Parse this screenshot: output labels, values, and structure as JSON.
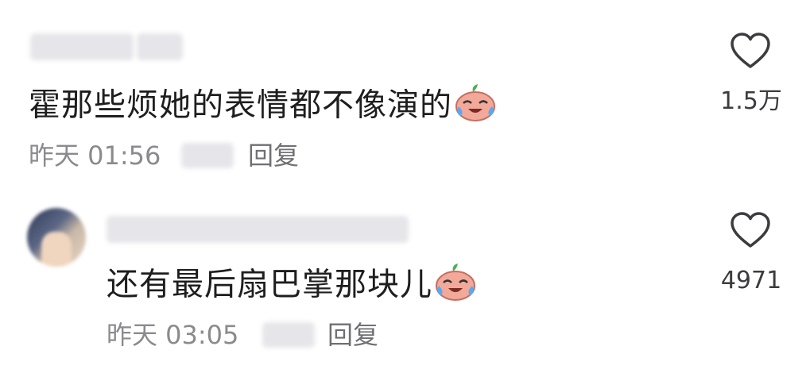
{
  "comments": [
    {
      "text": "霍那些烦她的表情都不像演的",
      "emoji": "crying-laughing-emoji",
      "time": "昨天 01:56",
      "reply_label": "回复",
      "likes": "1.5万"
    },
    {
      "text": "还有最后扇巴掌那块儿",
      "emoji": "crying-laughing-emoji",
      "time": "昨天 03:05",
      "reply_label": "回复",
      "likes": "4971"
    }
  ],
  "colors": {
    "text": "#1e1e1e",
    "meta": "#8a8a8f",
    "heart_stroke": "#3c3c40"
  }
}
